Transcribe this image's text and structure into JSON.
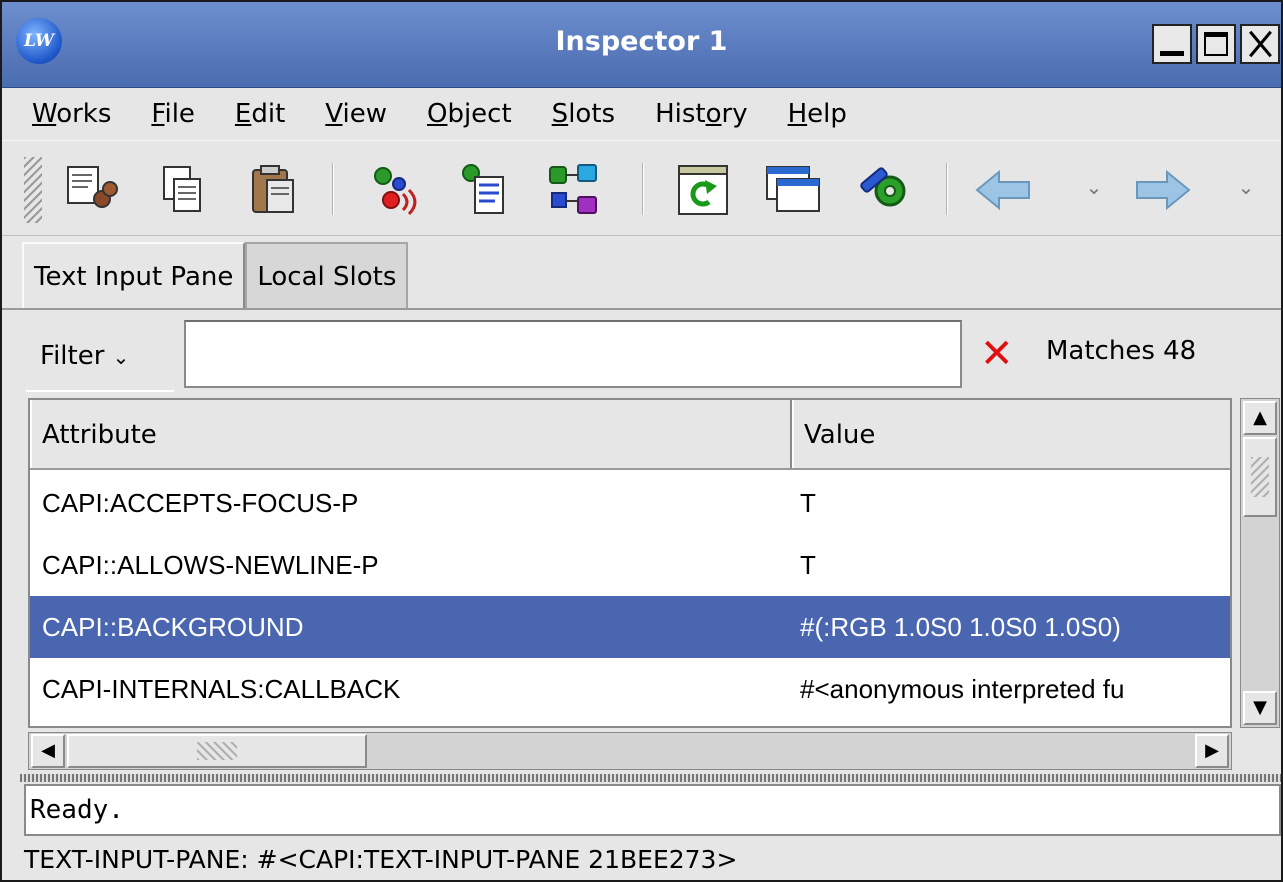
{
  "window": {
    "title": "Inspector 1",
    "app_icon_text": "LW"
  },
  "menu": [
    {
      "label": "Works"
    },
    {
      "label": "File"
    },
    {
      "label": "Edit"
    },
    {
      "label": "View"
    },
    {
      "label": "Object"
    },
    {
      "label": "Slots"
    },
    {
      "label": "History"
    },
    {
      "label": "Help"
    }
  ],
  "toolbar": {
    "icons": [
      "cut-icon",
      "copy-icon",
      "paste-icon",
      "listen-icon",
      "browse-icon",
      "class-icon",
      "refresh-icon",
      "window-icon",
      "configure-icon",
      "back-arrow-icon",
      "forward-arrow-icon"
    ]
  },
  "tabs": [
    {
      "label": "Text Input Pane",
      "active": true
    },
    {
      "label": "Local Slots",
      "active": false
    }
  ],
  "filter": {
    "label": "Filter",
    "value": "",
    "matches_label": "Matches 48"
  },
  "table": {
    "columns": [
      "Attribute",
      "Value"
    ],
    "rows": [
      {
        "attribute": "CAPI:ACCEPTS-FOCUS-P",
        "value": "T"
      },
      {
        "attribute": "CAPI::ALLOWS-NEWLINE-P",
        "value": "T"
      },
      {
        "attribute": "CAPI::BACKGROUND",
        "value": "#(:RGB 1.0S0 1.0S0 1.0S0)",
        "selected": true
      },
      {
        "attribute": "CAPI-INTERNALS:CALLBACK",
        "value": "#<anonymous interpreted fu"
      }
    ]
  },
  "echo": "Ready.",
  "status": "TEXT-INPUT-PANE: #<CAPI:TEXT-INPUT-PANE  21BEE273>",
  "colors": {
    "titlebar": "#4a6cb0",
    "selection": "#4a66b1",
    "clear_icon": "#e01010"
  }
}
